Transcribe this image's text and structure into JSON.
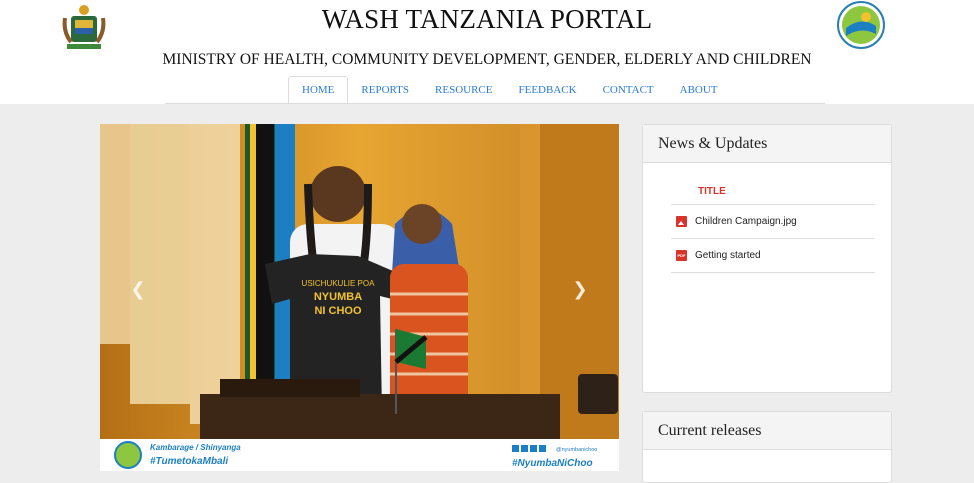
{
  "header": {
    "title": "WASH TANZANIA PORTAL",
    "subtitle": "MINISTRY OF HEALTH, COMMUNITY DEVELOPMENT, GENDER, ELDERLY AND CHILDREN"
  },
  "nav": [
    {
      "label": "HOME"
    },
    {
      "label": "REPORTS"
    },
    {
      "label": "RESOURCE"
    },
    {
      "label": "FEEDBACK"
    },
    {
      "label": "CONTACT"
    },
    {
      "label": "ABOUT"
    }
  ],
  "carousel": {
    "shirt_line1": "USICHUKULIE POA",
    "shirt_line2": "NYUMBA",
    "shirt_line3": "NI CHOO",
    "banner_location": "Kambarage / Shinyanga",
    "banner_tag_left": "#TumetokaMbali",
    "banner_handle": "@nyumbanichoo",
    "banner_tag_right": "#NyumbaNiChoo",
    "prev_icon": "chevron-left-icon",
    "next_icon": "chevron-right-icon"
  },
  "news": {
    "heading": "News & Updates",
    "column_title": "TITLE",
    "items": [
      {
        "icon": "image-file-icon",
        "label": "Children Campaign.jpg"
      },
      {
        "icon": "pdf-file-icon",
        "label": "Getting started",
        "badge": "PDF"
      }
    ]
  },
  "releases": {
    "heading": "Current releases"
  },
  "colors": {
    "link": "#2a7bd6",
    "accent_red": "#d9342b",
    "banner_blue": "#1c7fc4"
  }
}
